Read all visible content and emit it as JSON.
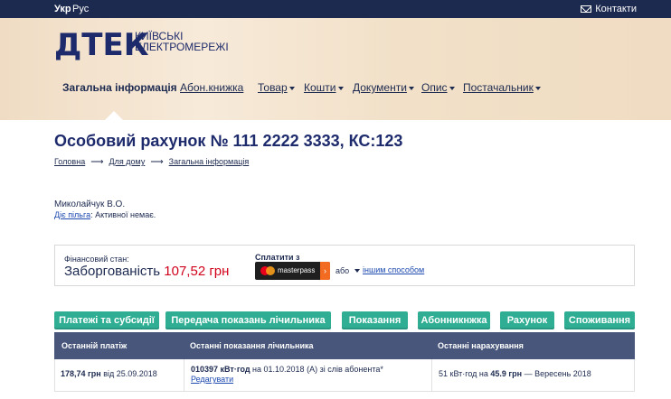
{
  "topbar": {
    "lang_ua": "Укр",
    "lang_ru": "Рус",
    "contacts": "Контакти"
  },
  "logo": {
    "main": "ДТЕК",
    "line1": "КИЇВСЬКІ",
    "line2": "ЕЛЕКТРОМЕРЕЖІ"
  },
  "nav": {
    "items": [
      {
        "label": "Загальна інформація",
        "active": true
      },
      {
        "label": "Абон.книжка",
        "active": false
      },
      {
        "label": "Товар",
        "active": false,
        "dropdown": true
      },
      {
        "label": "Кошти",
        "active": false,
        "dropdown": true
      },
      {
        "label": "Документи",
        "active": false,
        "dropdown": true
      },
      {
        "label": "Опис",
        "active": false,
        "dropdown": true
      },
      {
        "label": "Постачальник",
        "active": false,
        "dropdown": true
      }
    ]
  },
  "page": {
    "title": "Особовий рахунок № 111 2222 3333, КС:123",
    "breadcrumb": [
      "Головна",
      "Для дому",
      "Загальна інформація"
    ]
  },
  "customer": {
    "name": "Миколайчук В.О.",
    "benefit_link": "Діє пільга",
    "benefit_text": ": Активної немає."
  },
  "finance": {
    "label": "Фінансовий стан:",
    "status": "Заборгованість",
    "amount": "107,52 грн",
    "pay_label": "Сплатити з",
    "masterpass": "masterpass",
    "or": "або",
    "other_way": "іншим способом"
  },
  "buttons": [
    "Платежі та субсидії",
    "Передача показань лічильника",
    "Показання",
    "Абонникнжка",
    "Рахунок",
    "Споживання"
  ],
  "table": {
    "headers": [
      "Останній платіж",
      "Останні показання лічильника",
      "Останні нарахування"
    ],
    "row": {
      "payment_amount": "178,74 грн",
      "payment_date_text": " від 25.09.2018",
      "meter_value": "010397 кВт·год",
      "meter_text": " на 01.10.2018 (А) зі слів абонента*",
      "meter_edit": "Редагувати",
      "charge_kwh": "51 кВт·год на ",
      "charge_amount": "45.9 грн",
      "charge_period": " — Вересень 2018"
    }
  },
  "colors": {
    "topbar": "#1d2a50",
    "brand_blue": "#1d2a6b",
    "button_teal": "#2fae94",
    "table_header": "#47567a",
    "debt_red": "#d0021b",
    "masterpass_orange": "#f26b21"
  }
}
